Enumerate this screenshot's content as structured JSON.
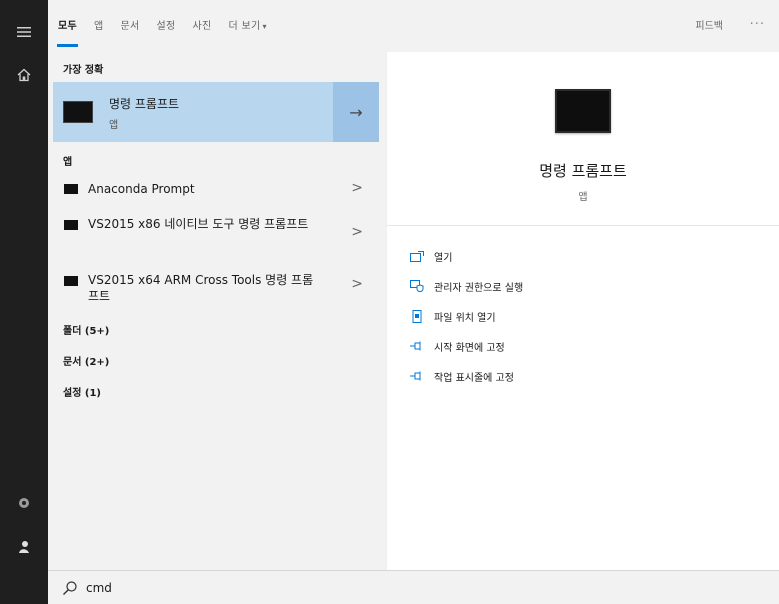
{
  "tabs": [
    {
      "label": "모두",
      "active": true
    },
    {
      "label": "앱"
    },
    {
      "label": "문서"
    },
    {
      "label": "설정"
    },
    {
      "label": "사진"
    },
    {
      "label": "더 보기"
    }
  ],
  "more_arrow": "▾",
  "feedback": "피드백",
  "ellipsis": "···",
  "best_match": {
    "header": "가장 정확",
    "title": "명령 프롬프트",
    "subtitle": "앱",
    "arrow": "→"
  },
  "apps_header": "앱",
  "apps": [
    {
      "label": "Anaconda Prompt"
    },
    {
      "label": "VS2015 x86 네이티브 도구 명령 프롬프트"
    },
    {
      "label": "VS2015 x64 ARM Cross Tools 명령 프롬프트"
    }
  ],
  "chevron": ">",
  "categories": [
    {
      "label": "폴더 (5+)"
    },
    {
      "label": "문서 (2+)"
    },
    {
      "label": "설정 (1)"
    }
  ],
  "preview": {
    "title": "명령 프롬프트",
    "subtitle": "앱",
    "actions": [
      {
        "label": "열기",
        "icon": "open-icon"
      },
      {
        "label": "관리자 권한으로 실행",
        "icon": "shield-icon"
      },
      {
        "label": "파일 위치 열기",
        "icon": "file-location-icon"
      },
      {
        "label": "시작 화면에 고정",
        "icon": "pin-icon"
      },
      {
        "label": "작업 표시줄에 고정",
        "icon": "pin-icon"
      }
    ]
  },
  "search": {
    "query": "cmd"
  },
  "colors": {
    "accent": "#0078d7",
    "selected_bg": "#b8d7ef",
    "rail_bg": "#1f1f1f"
  }
}
